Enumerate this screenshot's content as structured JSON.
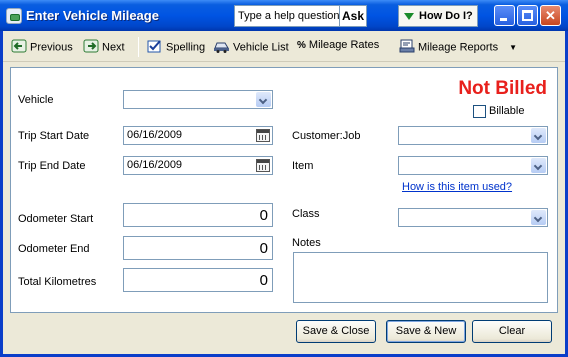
{
  "window": {
    "title": "Enter Vehicle Mileage",
    "help_placeholder": "Type a help question",
    "ask_label": "Ask",
    "howdo_label": "How Do I?"
  },
  "toolbar": {
    "previous": "Previous",
    "next": "Next",
    "spelling": "Spelling",
    "vehicle_list": "Vehicle List",
    "mileage_rates": "Mileage Rates",
    "mileage_reports": "Mileage Reports"
  },
  "form": {
    "vehicle_label": "Vehicle",
    "vehicle_value": "",
    "trip_start_label": "Trip Start Date",
    "trip_start_value": "06/16/2009",
    "trip_end_label": "Trip End Date",
    "trip_end_value": "06/16/2009",
    "odometer_start_label": "Odometer Start",
    "odometer_start_value": "0",
    "odometer_end_label": "Odometer End",
    "odometer_end_value": "0",
    "total_km_label": "Total Kilometres",
    "total_km_value": "0",
    "status": "Not Billed",
    "billable_label": "Billable",
    "billable_checked": false,
    "customer_job_label": "Customer:Job",
    "item_label": "Item",
    "item_help_link": "How is this item used?",
    "class_label": "Class",
    "notes_label": "Notes",
    "notes_value": ""
  },
  "buttons": {
    "save_close": "Save & Close",
    "save_new": "Save & New",
    "clear": "Clear"
  },
  "colors": {
    "status_red": "#e8201c",
    "title_blue": "#0054e3",
    "link_blue": "#0033cc"
  }
}
